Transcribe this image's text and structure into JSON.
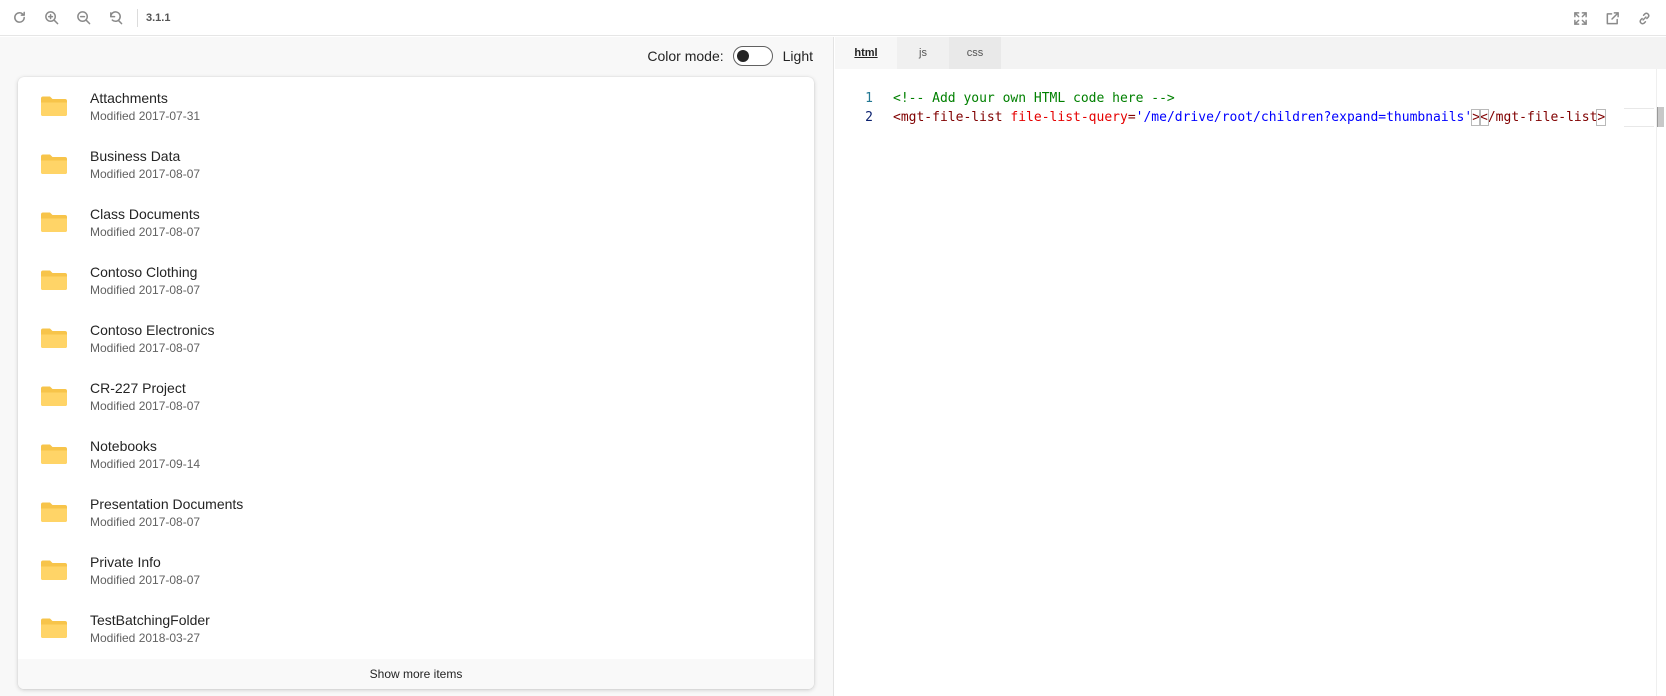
{
  "toolbar": {
    "version": "3.1.1",
    "left_icons": [
      "refresh-icon",
      "zoom-in-icon",
      "zoom-out-icon",
      "reset-zoom-icon"
    ],
    "right_icons": [
      "fullscreen-icon",
      "open-external-icon",
      "link-icon"
    ]
  },
  "preview": {
    "color_mode_label": "Color mode:",
    "color_mode_value": "Light",
    "files": [
      {
        "name": "Attachments",
        "modified": "Modified 2017-07-31"
      },
      {
        "name": "Business Data",
        "modified": "Modified 2017-08-07"
      },
      {
        "name": "Class Documents",
        "modified": "Modified 2017-08-07"
      },
      {
        "name": "Contoso Clothing",
        "modified": "Modified 2017-08-07"
      },
      {
        "name": "Contoso Electronics",
        "modified": "Modified 2017-08-07"
      },
      {
        "name": "CR-227 Project",
        "modified": "Modified 2017-08-07"
      },
      {
        "name": "Notebooks",
        "modified": "Modified 2017-09-14"
      },
      {
        "name": "Presentation Documents",
        "modified": "Modified 2017-08-07"
      },
      {
        "name": "Private Info",
        "modified": "Modified 2017-08-07"
      },
      {
        "name": "TestBatchingFolder",
        "modified": "Modified 2018-03-27"
      }
    ],
    "show_more_label": "Show more items"
  },
  "editor": {
    "tabs": [
      {
        "label": "html",
        "active": true
      },
      {
        "label": "js",
        "active": false
      },
      {
        "label": "css",
        "active": false
      }
    ],
    "lines": {
      "n1": "1",
      "n2": "2",
      "line1": "<!-- Add your own HTML code here -->",
      "l2_open": "<mgt-file-list",
      "l2_attr": "file-list-query",
      "l2_eq": "=",
      "l2_val": "'/me/drive/root/children?expand=thumbnails'",
      "l2_gt": ">",
      "l2_lt": "<",
      "l2_close": "/mgt-file-list",
      "l2_end": ">"
    }
  },
  "colors": {
    "folder": "#F7C44A",
    "folder_front": "#FFD467",
    "comment": "#008000",
    "tag": "#800000",
    "attr": "#E50000",
    "value": "#0000FF"
  }
}
